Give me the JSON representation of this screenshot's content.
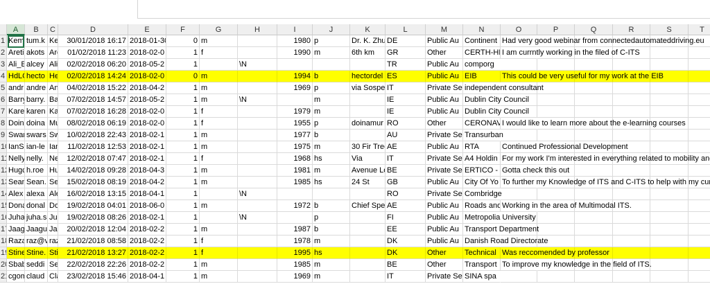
{
  "columns": [
    "A",
    "B",
    "C",
    "D",
    "E",
    "F",
    "G",
    "H",
    "I",
    "J",
    "K",
    "L",
    "M",
    "N",
    "O",
    "P",
    "Q",
    "R",
    "S",
    "T"
  ],
  "selected_column": "A",
  "highlight_color": "#ffff00",
  "rows": [
    {
      "n": "1",
      "hl": false,
      "c": [
        "Kemi",
        "tum.k",
        "Ke",
        "30/01/2018 16:17",
        "2018-01-30",
        "0",
        "m",
        "",
        "1980",
        "p",
        "Dr. K. Zhu",
        "DE",
        "Public Au",
        "Continent",
        "Had very good webinar from connectedautomateddriving.eu",
        "",
        "",
        "",
        "",
        ""
      ]
    },
    {
      "n": "2",
      "hl": false,
      "c": [
        "Areti",
        "akots",
        "Are",
        "01/02/2018 11:23",
        "2018-02-0",
        "1",
        "f",
        "",
        "1990",
        "m",
        "6th km",
        "GR",
        "Other",
        "CERTH-HI",
        "I am currntly working in the filed of C-ITS",
        "",
        "",
        "",
        "",
        ""
      ]
    },
    {
      "n": "3",
      "hl": false,
      "c": [
        "Ali_E",
        "alcey",
        "Ali",
        "02/02/2018 06:20",
        "2018-05-2",
        "1",
        "",
        "\\N",
        "",
        "",
        "",
        "TR",
        "Public Au",
        "comporg",
        "",
        "",
        "",
        "",
        "",
        ""
      ]
    },
    {
      "n": "4",
      "hl": true,
      "c": [
        "HdLC",
        "hecto",
        "He",
        "02/02/2018 14:24",
        "2018-02-0",
        "0",
        "m",
        "",
        "1994",
        "b",
        "hectordel",
        "ES",
        "Public Au",
        "EIB",
        "This could be very useful for my work at the EIB",
        "",
        "",
        "",
        "",
        ""
      ]
    },
    {
      "n": "5",
      "hl": false,
      "c": [
        "andr",
        "andre",
        "An",
        "04/02/2018 15:22",
        "2018-04-2",
        "1",
        "m",
        "",
        "1969",
        "p",
        "via Sospel",
        "IT",
        "Private Se",
        "independent consultant",
        "",
        "",
        "",
        "",
        "",
        ""
      ]
    },
    {
      "n": "6",
      "hl": false,
      "c": [
        "Barry",
        "barry.",
        "Bar",
        "07/02/2018 14:57",
        "2018-05-2",
        "1",
        "m",
        "\\N",
        "",
        "m",
        "",
        "IE",
        "Public Au",
        "Dublin City Council",
        "",
        "",
        "",
        "",
        "",
        ""
      ]
    },
    {
      "n": "7",
      "hl": false,
      "c": [
        "Karei",
        "karen",
        "Kar",
        "07/02/2018 16:28",
        "2018-02-0",
        "1",
        "f",
        "",
        "1979",
        "m",
        "",
        "IE",
        "Public Au",
        "Dublin City Council",
        "",
        "",
        "",
        "",
        "",
        ""
      ]
    },
    {
      "n": "8",
      "hl": false,
      "c": [
        "Doin",
        "doina",
        "Mu",
        "08/02/2018 06:19",
        "2018-02-0",
        "1",
        "f",
        "",
        "1955",
        "p",
        "doinamur",
        "RO",
        "Other",
        "CERONAV",
        "I would like to learn more about the e-learning courses",
        "",
        "",
        "",
        "",
        ""
      ]
    },
    {
      "n": "9",
      "hl": false,
      "c": [
        "Swar",
        "swars",
        "Sw",
        "10/02/2018 22:43",
        "2018-02-1",
        "1",
        "m",
        "",
        "1977",
        "b",
        "",
        "AU",
        "Private Se",
        "Transurban",
        "",
        "",
        "",
        "",
        "",
        ""
      ]
    },
    {
      "n": "10",
      "hl": false,
      "c": [
        "IanSr",
        "ian-le",
        "Ian",
        "11/02/2018 12:53",
        "2018-02-1",
        "1",
        "m",
        "",
        "1975",
        "m",
        "30 Fir Tree",
        "AE",
        "Public Au",
        "RTA",
        "Continued Professional Development",
        "",
        "",
        "",
        "",
        ""
      ]
    },
    {
      "n": "11",
      "hl": false,
      "c": [
        "Nelly",
        "nelly.",
        "Nel",
        "12/02/2018 07:47",
        "2018-02-1",
        "1",
        "f",
        "",
        "1968",
        "hs",
        "Via",
        "IT",
        "Private Se",
        "A4 Holdin",
        "For my work I'm interested in everything related to mobility and tra",
        "",
        "",
        "",
        "",
        ""
      ]
    },
    {
      "n": "12",
      "hl": false,
      "c": [
        "Hugc",
        "h.roe",
        "Hug",
        "14/02/2018 09:28",
        "2018-04-3",
        "1",
        "m",
        "",
        "1981",
        "m",
        "Avenue Lo",
        "BE",
        "Private Se",
        "ERTICO - I",
        "Gotta check this out",
        "",
        "",
        "",
        "",
        ""
      ]
    },
    {
      "n": "13",
      "hl": false,
      "c": [
        "Sean",
        "Sean.",
        "Sea",
        "15/02/2018 08:19",
        "2018-04-2",
        "1",
        "m",
        "",
        "1985",
        "hs",
        "24 St",
        "GB",
        "Public Au",
        "City Of Yo",
        "To further my Knowledge of ITS and C-ITS to help with my current jo",
        "",
        "",
        "",
        "",
        ""
      ]
    },
    {
      "n": "14",
      "hl": false,
      "c": [
        "Alex",
        "alexa",
        "Ale",
        "16/02/2018 13:15",
        "2018-04-1",
        "1",
        "",
        "\\N",
        "",
        "",
        "",
        "RO",
        "Private Se",
        "Combridge",
        "",
        "",
        "",
        "",
        "",
        ""
      ]
    },
    {
      "n": "15",
      "hl": false,
      "c": [
        "Dona",
        "donal",
        "Dor",
        "19/02/2018 04:01",
        "2018-06-0",
        "1",
        "m",
        "",
        "1972",
        "b",
        "Chief Spe",
        "AE",
        "Public Au",
        "Roads and",
        "Working in the area of Multimodal ITS.",
        "",
        "",
        "",
        "",
        ""
      ]
    },
    {
      "n": "16",
      "hl": false,
      "c": [
        "Juha",
        "juha.s",
        "Juh",
        "19/02/2018 08:26",
        "2018-02-1",
        "1",
        "",
        "\\N",
        "",
        "p",
        "",
        "FI",
        "Public Au",
        "Metropolia University",
        "",
        "",
        "",
        "",
        "",
        ""
      ]
    },
    {
      "n": "17",
      "hl": false,
      "c": [
        "Jaagu",
        "Jaagu",
        "Jaa",
        "20/02/2018 12:04",
        "2018-02-2",
        "1",
        "m",
        "",
        "1987",
        "b",
        "",
        "EE",
        "Public Au",
        "Transport Department",
        "",
        "",
        "",
        "",
        "",
        ""
      ]
    },
    {
      "n": "18",
      "hl": false,
      "c": [
        "Raza",
        "raz@v",
        "raz",
        "21/02/2018 08:58",
        "2018-02-2",
        "1",
        "f",
        "",
        "1978",
        "m",
        "",
        "DK",
        "Public Au",
        "Danish Road Directorate",
        "",
        "",
        "",
        "",
        "",
        ""
      ]
    },
    {
      "n": "19",
      "hl": true,
      "c": [
        "Stine",
        "Stine.",
        "Stir",
        "21/02/2018 13:27",
        "2018-02-2",
        "1",
        "f",
        "",
        "1995",
        "hs",
        "",
        "DK",
        "Other",
        "Technical",
        "Was reccomended by professor",
        "",
        "",
        "",
        "",
        ""
      ]
    },
    {
      "n": "20",
      "hl": false,
      "c": [
        "Sbab",
        "seddi",
        "Sec",
        "22/02/2018 22:26",
        "2018-02-2",
        "1",
        "m",
        "",
        "1985",
        "m",
        "",
        "BE",
        "Other",
        "Transport",
        "To improve my knowledge in the field of ITS.",
        "",
        "",
        "",
        "",
        ""
      ]
    },
    {
      "n": "21",
      "hl": false,
      "c": [
        "cgom",
        "claud",
        "Cla",
        "23/02/2018 15:46",
        "2018-04-1",
        "1",
        "m",
        "",
        "1969",
        "m",
        "",
        "IT",
        "Private Se",
        "SINA spa",
        "",
        "",
        "",
        "",
        "",
        ""
      ]
    }
  ]
}
